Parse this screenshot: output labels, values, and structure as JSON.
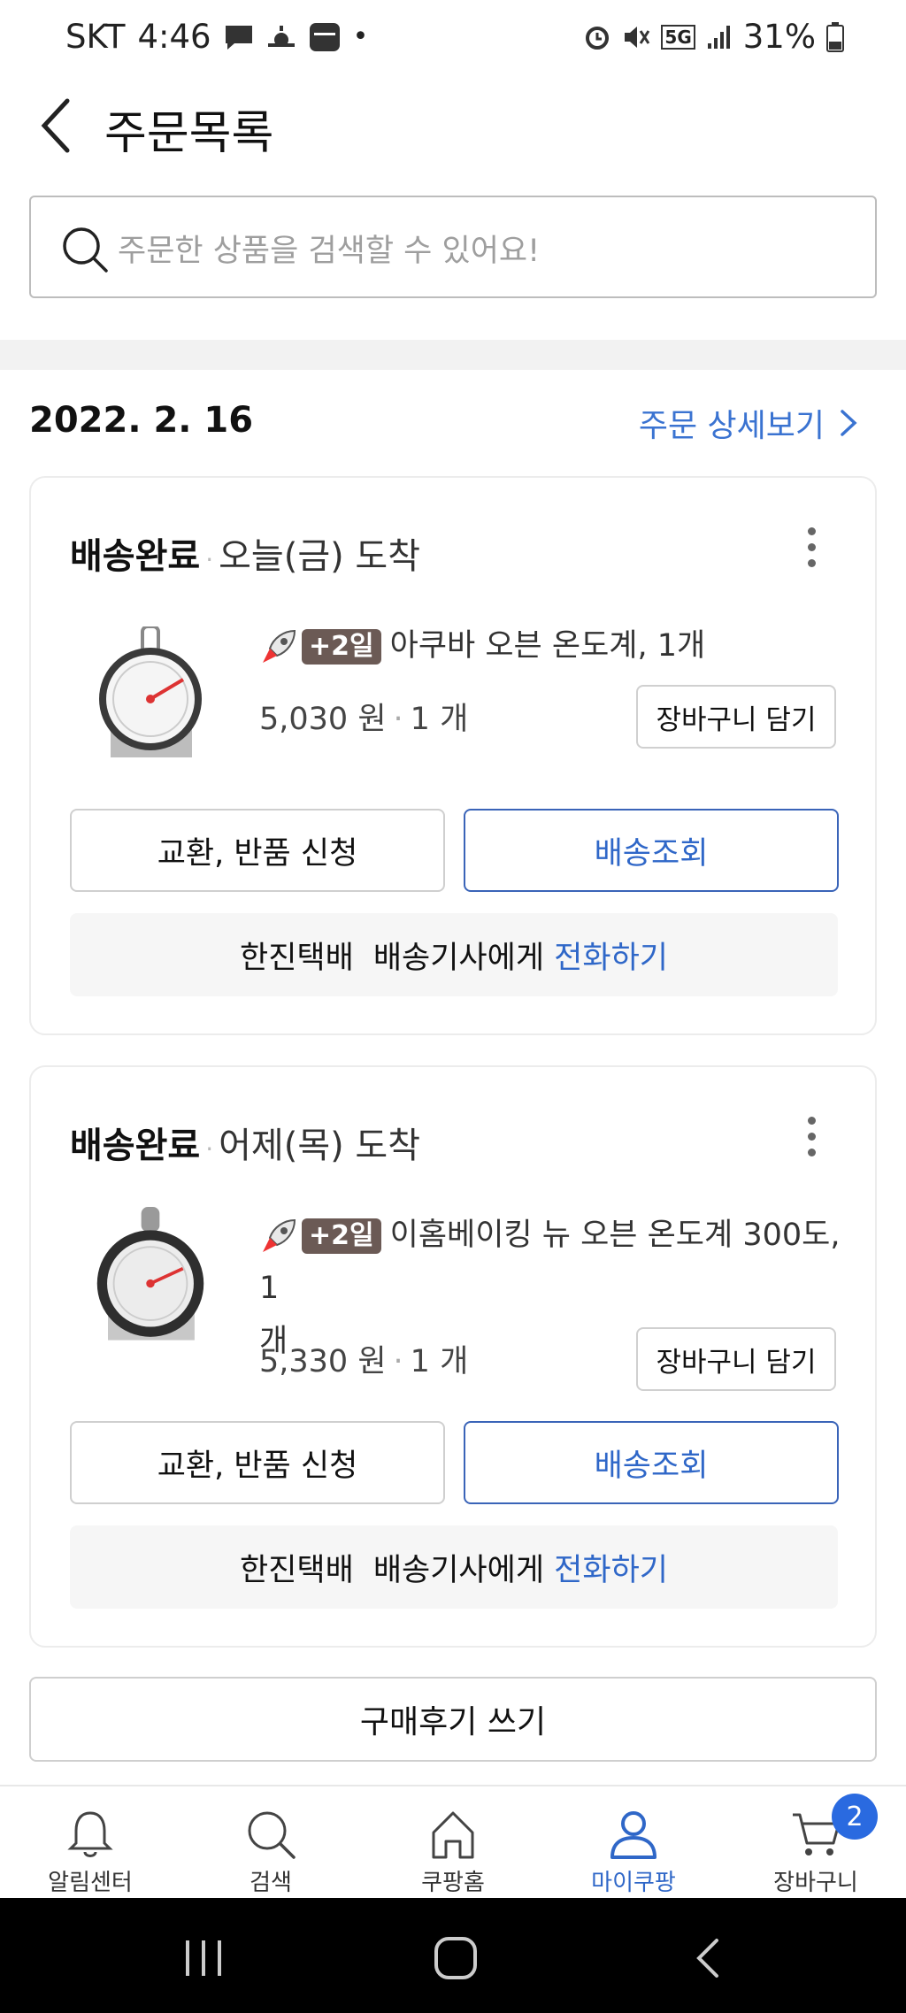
{
  "status_bar": {
    "carrier": "SKT",
    "time": "4:46",
    "battery": "31%",
    "network": "5G"
  },
  "header": {
    "title": "주문목록"
  },
  "search": {
    "placeholder": "주문한 상품을 검색할 수 있어요!"
  },
  "order": {
    "date": "2022. 2. 16",
    "detail_label": "주문 상세보기",
    "shipments": [
      {
        "status": "배송완료",
        "arrival": "오늘(금) 도착",
        "badge": "+2일",
        "product_name": "아쿠바 오븐 온도계, 1개",
        "price": "5,030 원",
        "qty": "1 개",
        "cart_label": "장바구니 담기",
        "exchange_label": "교환, 반품 신청",
        "track_label": "배송조회",
        "courier": "한진택배",
        "driver_text": "배송기사에게",
        "call_label": "전화하기"
      },
      {
        "status": "배송완료",
        "arrival": "어제(목) 도착",
        "badge": "+2일",
        "product_name_line1": "이홈베이킹 뉴 오븐 온도계 300도, 1",
        "product_name_line2": "개",
        "price": "5,330 원",
        "qty": "1 개",
        "cart_label": "장바구니 담기",
        "exchange_label": "교환, 반품 신청",
        "track_label": "배송조회",
        "courier": "한진택배",
        "driver_text": "배송기사에게",
        "call_label": "전화하기"
      }
    ],
    "review_label": "구매후기 쓰기"
  },
  "tabbar": {
    "items": [
      {
        "label": "알림센터",
        "icon": "bell-icon"
      },
      {
        "label": "검색",
        "icon": "search-icon"
      },
      {
        "label": "쿠팡홈",
        "icon": "home-icon"
      },
      {
        "label": "마이쿠팡",
        "icon": "person-icon",
        "active": true
      },
      {
        "label": "장바구니",
        "icon": "cart-icon",
        "badge": "2"
      }
    ]
  },
  "colors": {
    "accent": "#2f67c8",
    "badge_bg": "#6b5a55",
    "cart_badge": "#2a6ae0"
  }
}
